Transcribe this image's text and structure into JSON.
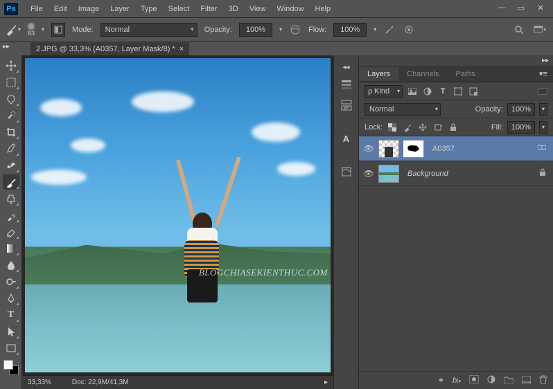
{
  "menu": {
    "items": [
      "File",
      "Edit",
      "Image",
      "Layer",
      "Type",
      "Select",
      "Filter",
      "3D",
      "View",
      "Window",
      "Help"
    ]
  },
  "options": {
    "brush_size": "83",
    "mode_label": "Mode:",
    "mode_value": "Normal",
    "opacity_label": "Opacity:",
    "opacity_value": "100%",
    "flow_label": "Flow:",
    "flow_value": "100%"
  },
  "document": {
    "tab_title": "2.JPG @ 33,3% (A0357, Layer Mask/8) *",
    "watermark": "BLOGCHIASEKIENTHUC.COM",
    "status_zoom": "33,33%",
    "status_doc": "Doc: 22,9M/41,3M"
  },
  "panels": {
    "tabs": {
      "layers": "Layers",
      "channels": "Channels",
      "paths": "Paths"
    },
    "filter_kind": "Kind",
    "blend_mode": "Normal",
    "opacity_label": "Opacity:",
    "opacity_value": "100%",
    "lock_label": "Lock:",
    "fill_label": "Fill:",
    "fill_value": "100%",
    "layers": [
      {
        "name": "A0357",
        "selected": true,
        "mask": true,
        "locked": false,
        "italic": false
      },
      {
        "name": "Background",
        "selected": false,
        "mask": false,
        "locked": true,
        "italic": true
      }
    ]
  },
  "filter_icon_label": "ρ"
}
